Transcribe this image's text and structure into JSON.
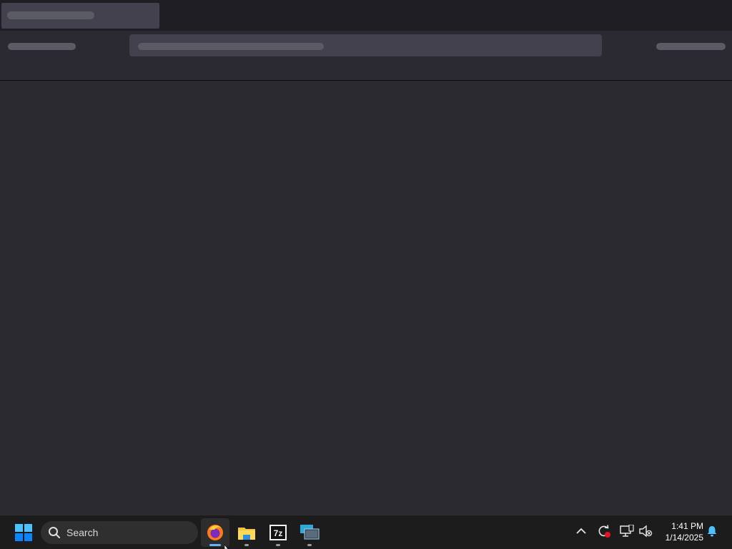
{
  "browser": {
    "state": "loading-skeleton",
    "tab_title": "",
    "url": ""
  },
  "taskbar": {
    "start_icon": "windows-start-icon",
    "search": {
      "label": "Search",
      "icon": "search-icon"
    },
    "apps": [
      {
        "name": "firefox",
        "icon": "firefox-icon",
        "active": true
      },
      {
        "name": "file-explorer",
        "icon": "folder-icon",
        "active": false
      },
      {
        "name": "7-zip",
        "icon": "7zip-icon",
        "label": "7z",
        "active": false
      },
      {
        "name": "remote-desktop",
        "icon": "remote-desktop-icon",
        "active": false
      }
    ],
    "tray": {
      "icons": [
        "chevron-up-icon",
        "sync-error-icon",
        "network-icon",
        "volume-muted-icon",
        "notification-bell-icon"
      ],
      "time": "1:41 PM",
      "date": "1/14/2025"
    },
    "colors": {
      "accent": "#63b4f6",
      "windows_blue": "#0a84ff"
    }
  }
}
